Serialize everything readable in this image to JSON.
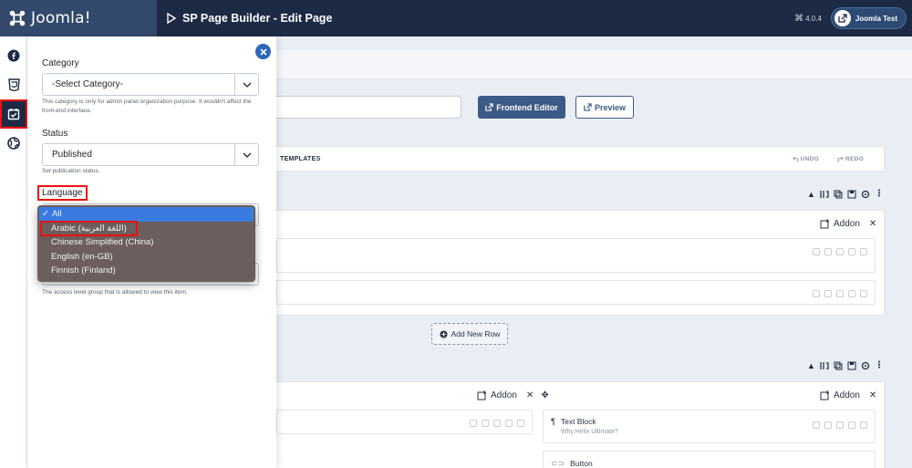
{
  "header": {
    "brand": "Joomla!",
    "page_title": "SP Page Builder - Edit Page",
    "version": "4.0.4",
    "user_label": "Joomla Test"
  },
  "rail": {
    "items": [
      {
        "icon": "facebook-icon"
      },
      {
        "icon": "css3-icon"
      },
      {
        "icon": "calendar-check-icon",
        "active": true
      },
      {
        "icon": "globe-icon"
      }
    ]
  },
  "panel": {
    "category": {
      "label": "Category",
      "value": "-Select Category-",
      "help": "This category is only for admin panel organization purpose. It wouldn't affect the front-end interface."
    },
    "status": {
      "label": "Status",
      "value": "Published",
      "help": "Set publication status."
    },
    "language": {
      "label": "Language",
      "options": [
        "All",
        "Arabic (اللغة العربية)",
        "Chinese Simplified (China)",
        "English (en-GB)",
        "Finnish (Finland)"
      ],
      "selected": "All",
      "highlighted": "Arabic (اللغة العربية)"
    },
    "access": {
      "help": "The access level group that is allowed to view this item."
    }
  },
  "main": {
    "buttons": {
      "frontend": "Frontend Editor",
      "preview": "Preview"
    },
    "toolbar": {
      "templates": "TEMPLATES",
      "undo": "UNDO",
      "redo": "REDO"
    },
    "addon_label": "Addon",
    "add_row": "Add New Row",
    "addons": [
      {
        "name": "Text Block",
        "subtitle": "Why Helix Ultimate?"
      },
      {
        "name": "Button",
        "subtitle": ""
      }
    ]
  },
  "colors": {
    "header_bg": "#1c2a44",
    "brand_bg": "#33496c",
    "accent": "#3c5a86",
    "dropdown_bg": "#6b5e5c",
    "selected_option": "#3a7be0",
    "highlight_box": "#ee1111"
  }
}
